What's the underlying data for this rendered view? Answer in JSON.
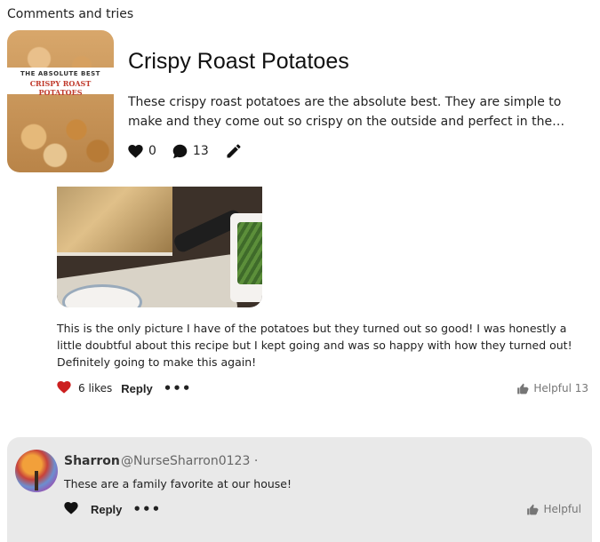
{
  "header": {
    "title": "Comments and tries"
  },
  "pin": {
    "image_banner_line1": "THE ABSOLUTE BEST",
    "image_banner_line2": "CRISPY ROAST POTATOES",
    "title": "Crispy Roast Potatoes",
    "description": "These crispy roast potatoes are the absolute best. They are simple to make and they come out so crispy on the outside and perfect in the middle. Be...",
    "likes": "0",
    "comments": "13"
  },
  "comment": {
    "text": "This is the only picture I have of the potatoes but they turned out so good! I was honestly a little doubtful about this recipe but I kept going and was so happy with how they turned out! Definitely going to make this again!",
    "likes_label": "6 likes",
    "reply_label": "Reply",
    "more_label": "•••",
    "helpful_label": "Helpful 13",
    "heart_color": "#cc1f1f"
  },
  "reply": {
    "name": "Sharron",
    "handle": "@NurseSharron0123 ·",
    "text": "These are a family favorite at our house!",
    "reply_label": "Reply",
    "more_label": "•••",
    "helpful_label": "Helpful"
  }
}
